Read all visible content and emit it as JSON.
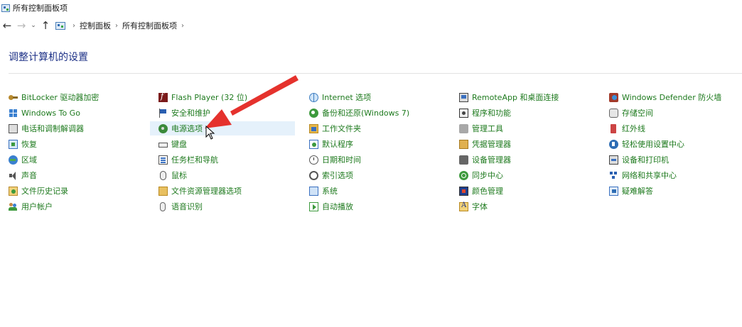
{
  "window": {
    "title": "所有控制面板项"
  },
  "nav": {
    "back": "←",
    "forward": "→",
    "recent": "⌄",
    "up": "↑",
    "separator": "›",
    "breadcrumbs": [
      "控制面板",
      "所有控制面板项"
    ]
  },
  "page": {
    "heading": "调整计算机的设置"
  },
  "columns": [
    {
      "items": [
        {
          "label": "BitLocker 驱动器加密",
          "icon": "bitlocker-icon"
        },
        {
          "label": "Windows To Go",
          "icon": "windows-to-go-icon"
        },
        {
          "label": "电话和调制解调器",
          "icon": "phone-modem-icon"
        },
        {
          "label": "恢复",
          "icon": "recovery-icon"
        },
        {
          "label": "区域",
          "icon": "region-icon"
        },
        {
          "label": "声音",
          "icon": "sound-icon"
        },
        {
          "label": "文件历史记录",
          "icon": "file-history-icon"
        },
        {
          "label": "用户帐户",
          "icon": "user-accounts-icon"
        }
      ]
    },
    {
      "items": [
        {
          "label": "Flash Player (32 位)",
          "icon": "flash-player-icon"
        },
        {
          "label": "安全和维护",
          "icon": "security-maintenance-icon"
        },
        {
          "label": "电源选项",
          "icon": "power-options-icon",
          "hover": true
        },
        {
          "label": "键盘",
          "icon": "keyboard-icon"
        },
        {
          "label": "任务栏和导航",
          "icon": "taskbar-icon"
        },
        {
          "label": "鼠标",
          "icon": "mouse-icon"
        },
        {
          "label": "文件资源管理器选项",
          "icon": "explorer-options-icon"
        },
        {
          "label": "语音识别",
          "icon": "speech-icon"
        }
      ]
    },
    {
      "items": [
        {
          "label": "Internet 选项",
          "icon": "internet-options-icon"
        },
        {
          "label": "备份和还原(Windows 7)",
          "icon": "backup-restore-icon"
        },
        {
          "label": "工作文件夹",
          "icon": "work-folders-icon"
        },
        {
          "label": "默认程序",
          "icon": "default-programs-icon"
        },
        {
          "label": "日期和时间",
          "icon": "date-time-icon"
        },
        {
          "label": "索引选项",
          "icon": "indexing-icon"
        },
        {
          "label": "系统",
          "icon": "system-icon"
        },
        {
          "label": "自动播放",
          "icon": "autoplay-icon"
        }
      ]
    },
    {
      "items": [
        {
          "label": "RemoteApp 和桌面连接",
          "icon": "remoteapp-icon"
        },
        {
          "label": "程序和功能",
          "icon": "programs-features-icon"
        },
        {
          "label": "管理工具",
          "icon": "admin-tools-icon"
        },
        {
          "label": "凭据管理器",
          "icon": "credential-manager-icon"
        },
        {
          "label": "设备管理器",
          "icon": "device-manager-icon"
        },
        {
          "label": "同步中心",
          "icon": "sync-center-icon"
        },
        {
          "label": "颜色管理",
          "icon": "color-management-icon"
        },
        {
          "label": "字体",
          "icon": "fonts-icon"
        }
      ]
    },
    {
      "items": [
        {
          "label": "Windows Defender 防火墙",
          "icon": "firewall-icon"
        },
        {
          "label": "存储空间",
          "icon": "storage-spaces-icon"
        },
        {
          "label": "红外线",
          "icon": "infrared-icon"
        },
        {
          "label": "轻松使用设置中心",
          "icon": "ease-of-access-icon"
        },
        {
          "label": "设备和打印机",
          "icon": "devices-printers-icon"
        },
        {
          "label": "网络和共享中心",
          "icon": "network-sharing-icon"
        },
        {
          "label": "疑难解答",
          "icon": "troubleshooting-icon"
        }
      ]
    }
  ]
}
